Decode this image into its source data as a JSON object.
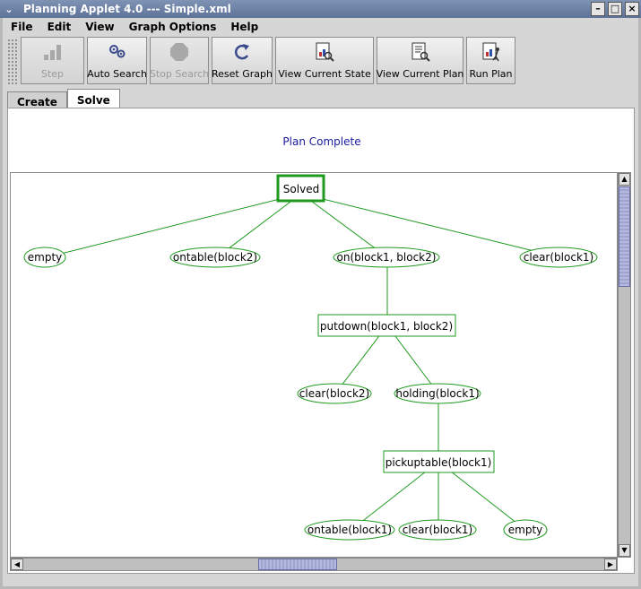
{
  "window": {
    "title": "Planning Applet 4.0 --- Simple.xml",
    "menu_glyph": "⌄",
    "minimize_glyph": "–",
    "maximize_glyph": "□",
    "close_glyph": "×"
  },
  "menubar": {
    "items": [
      "File",
      "Edit",
      "View",
      "Graph Options",
      "Help"
    ]
  },
  "toolbar": {
    "buttons": [
      {
        "label": "Step",
        "icon": "step-icon",
        "enabled": false
      },
      {
        "label": "Auto Search",
        "icon": "auto-search-icon",
        "enabled": true
      },
      {
        "label": "Stop Search",
        "icon": "stop-icon",
        "enabled": false
      },
      {
        "label": "Reset Graph",
        "icon": "reset-icon",
        "enabled": true
      },
      {
        "label": "View Current State",
        "icon": "view-state-icon",
        "enabled": true
      },
      {
        "label": "View Current Plan",
        "icon": "view-plan-icon",
        "enabled": true
      },
      {
        "label": "Run Plan",
        "icon": "run-plan-icon",
        "enabled": true
      }
    ]
  },
  "tabs": [
    {
      "label": "Create",
      "active": false
    },
    {
      "label": "Solve",
      "active": true
    }
  ],
  "status": {
    "message": "Plan Complete"
  },
  "graph": {
    "edge_color": "#1f9a1f",
    "nodes": {
      "solved": "Solved",
      "empty_top": "empty",
      "ontable_block2": "ontable(block2)",
      "on_block1_block2": "on(block1, block2)",
      "clear_block1_top": "clear(block1)",
      "putdown": "putdown(block1, block2)",
      "clear_block2": "clear(block2)",
      "holding_block1": "holding(block1)",
      "pickuptable": "pickuptable(block1)",
      "ontable_block1": "ontable(block1)",
      "clear_block1_bottom": "clear(block1)",
      "empty_bottom": "empty"
    }
  }
}
